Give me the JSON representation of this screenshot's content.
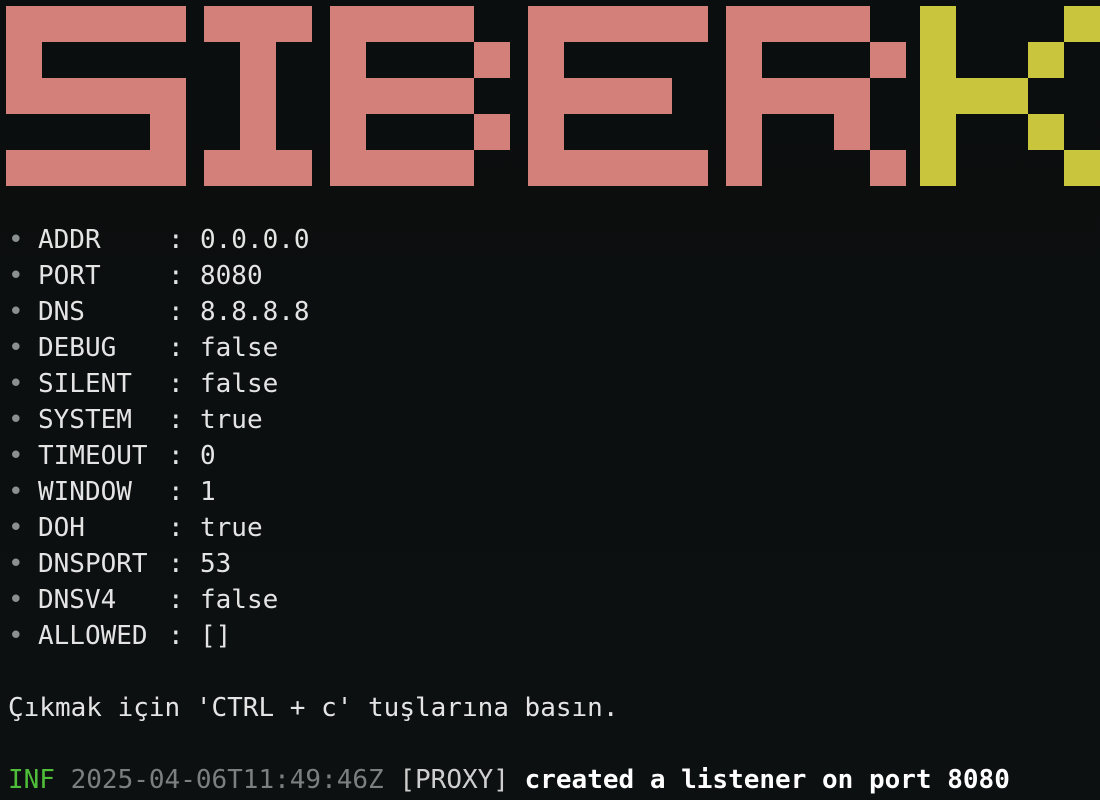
{
  "banner": {
    "left_text": "SIBER",
    "right_text": "KURT",
    "left_color": "#d4807a",
    "right_color": "#c9c53c"
  },
  "config": [
    {
      "key": "ADDR",
      "value": "0.0.0.0"
    },
    {
      "key": "PORT",
      "value": "8080"
    },
    {
      "key": "DNS",
      "value": "8.8.8.8"
    },
    {
      "key": "DEBUG",
      "value": "false"
    },
    {
      "key": "SILENT",
      "value": "false"
    },
    {
      "key": "SYSTEM",
      "value": "true"
    },
    {
      "key": "TIMEOUT",
      "value": "0"
    },
    {
      "key": "WINDOW",
      "value": "1"
    },
    {
      "key": "DOH",
      "value": "true"
    },
    {
      "key": "DNSPORT",
      "value": "53"
    },
    {
      "key": "DNSV4",
      "value": "false"
    },
    {
      "key": "ALLOWED",
      "value": "[]"
    }
  ],
  "bullet_char": "•",
  "separator": ":",
  "hint": "Çıkmak için 'CTRL + c' tuşlarına basın.",
  "log": {
    "level": "INF",
    "timestamp": "2025-04-06T11:49:46Z",
    "tag": "[PROXY]",
    "message": "created a listener on port 8080",
    "level_color": "#4fbf3a"
  }
}
